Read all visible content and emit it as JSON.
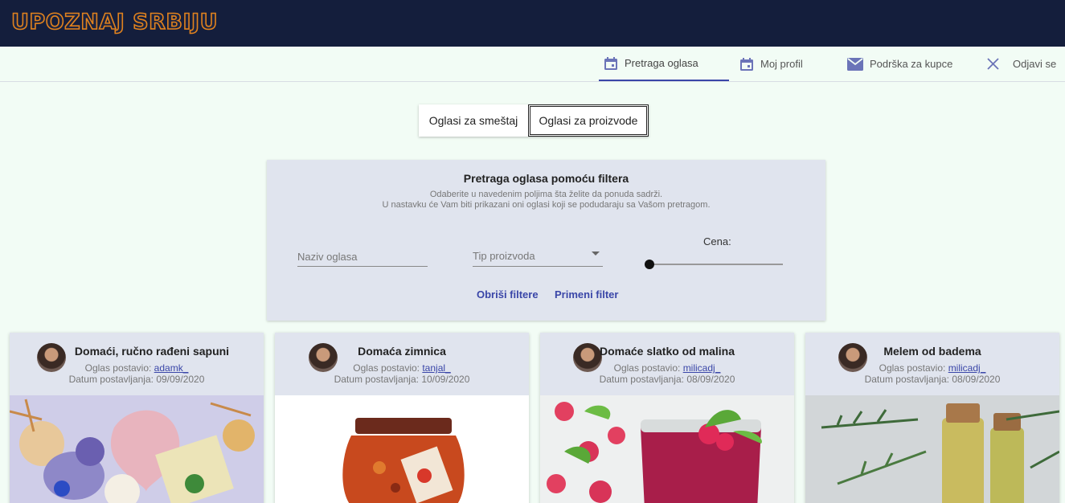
{
  "header": {
    "logo_text": "UPOZNAJ SRBIJU",
    "accent_color": "#e0821e"
  },
  "nav": {
    "items": [
      {
        "label": "Pretraga oglasa",
        "icon": "calendar-icon",
        "active": true
      },
      {
        "label": "Moj profil",
        "icon": "calendar-icon",
        "active": false
      },
      {
        "label": "Podrška za kupce",
        "icon": "mail-icon",
        "active": false
      },
      {
        "label": "Odjavi se",
        "icon": "close-icon",
        "active": false
      }
    ]
  },
  "toggle": {
    "option1": "Oglasi za smeštaj",
    "option2": "Oglasi za proizvode",
    "selected": "Oglasi za proizvode"
  },
  "filter": {
    "title": "Pretraga oglasa pomoću filtera",
    "subtitle1": "Odaberite u navedenim poljima šta želite da ponuda sadrži.",
    "subtitle2": "U nastavku će Vam biti prikazani oni oglasi koji se podudaraju sa Vašom pretragom.",
    "name_placeholder": "Naziv oglasa",
    "type_placeholder": "Tip proizvoda",
    "price_label": "Cena:",
    "price_value": 0,
    "clear_label": "Obriši filtere",
    "apply_label": "Primeni filter"
  },
  "cards": [
    {
      "title": "Domaći, ručno rađeni sapuni",
      "posted_by_label": "Oglas postavio:",
      "user": "adamk_",
      "date_label": "Datum postavljanja:",
      "date": "09/09/2020"
    },
    {
      "title": "Domaća zimnica",
      "posted_by_label": "Oglas postavio:",
      "user": "tanjal_",
      "date_label": "Datum postavljanja:",
      "date": "10/09/2020"
    },
    {
      "title": "Domaće slatko od malina",
      "posted_by_label": "Oglas postavio:",
      "user": "milicadj_",
      "date_label": "Datum postavljanja:",
      "date": "08/09/2020"
    },
    {
      "title": "Melem od badema",
      "posted_by_label": "Oglas postavio:",
      "user": "milicadj_",
      "date_label": "Datum postavljanja:",
      "date": "08/09/2020"
    }
  ]
}
